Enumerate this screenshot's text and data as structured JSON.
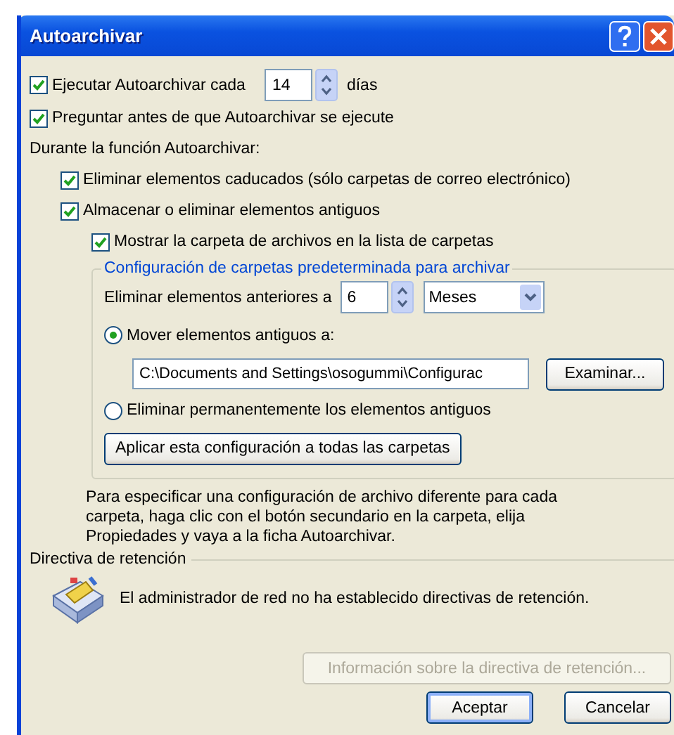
{
  "window": {
    "title": "Autoarchivar"
  },
  "autoarchive": {
    "label": "Ejecutar Autoarchivar cada",
    "checked": true,
    "value": "14",
    "unit": "días"
  },
  "prompt": {
    "label": "Preguntar antes de que Autoarchivar se ejecute",
    "checked": true
  },
  "during_label": "Durante la función Autoarchivar:",
  "during_options": [
    {
      "label": "Eliminar elementos caducados (sólo carpetas de correo electrónico)",
      "checked": true
    },
    {
      "label": "Almacenar o eliminar elementos antiguos",
      "checked": true,
      "children": [
        {
          "label": "Mostrar la carpeta de archivos en la lista de carpetas",
          "checked": true
        }
      ]
    }
  ],
  "default_settings": {
    "title": "Configuración de carpetas predeterminada para archivar",
    "older_than_label": "Eliminar elementos anteriores a",
    "older_than_value": "6",
    "period": "Meses",
    "actions": [
      {
        "kind": "move",
        "label": "Mover elementos antiguos a:",
        "selected": true,
        "path": "C:\\Documents and Settings\\osogummi\\Configurac",
        "browse": "Examinar..."
      },
      {
        "kind": "delete",
        "label": "Eliminar permanentemente los elementos antiguos",
        "selected": false
      }
    ],
    "apply_button": "Aplicar esta configuración a todas las carpetas"
  },
  "note": "Para especificar una configuración de archivo diferente para cada carpeta, haga clic con el botón secundario en la carpeta, elija Propiedades y vaya a la ficha Autoarchivar.",
  "retention": {
    "title": "Directiva de retención",
    "message": "El administrador de red no ha establecido directivas de retención.",
    "info_button": {
      "label": "Información sobre la directiva de retención...",
      "disabled": true
    }
  },
  "buttons": [
    {
      "label": "Aceptar",
      "default": true
    },
    {
      "label": "Cancelar",
      "default": false
    }
  ]
}
